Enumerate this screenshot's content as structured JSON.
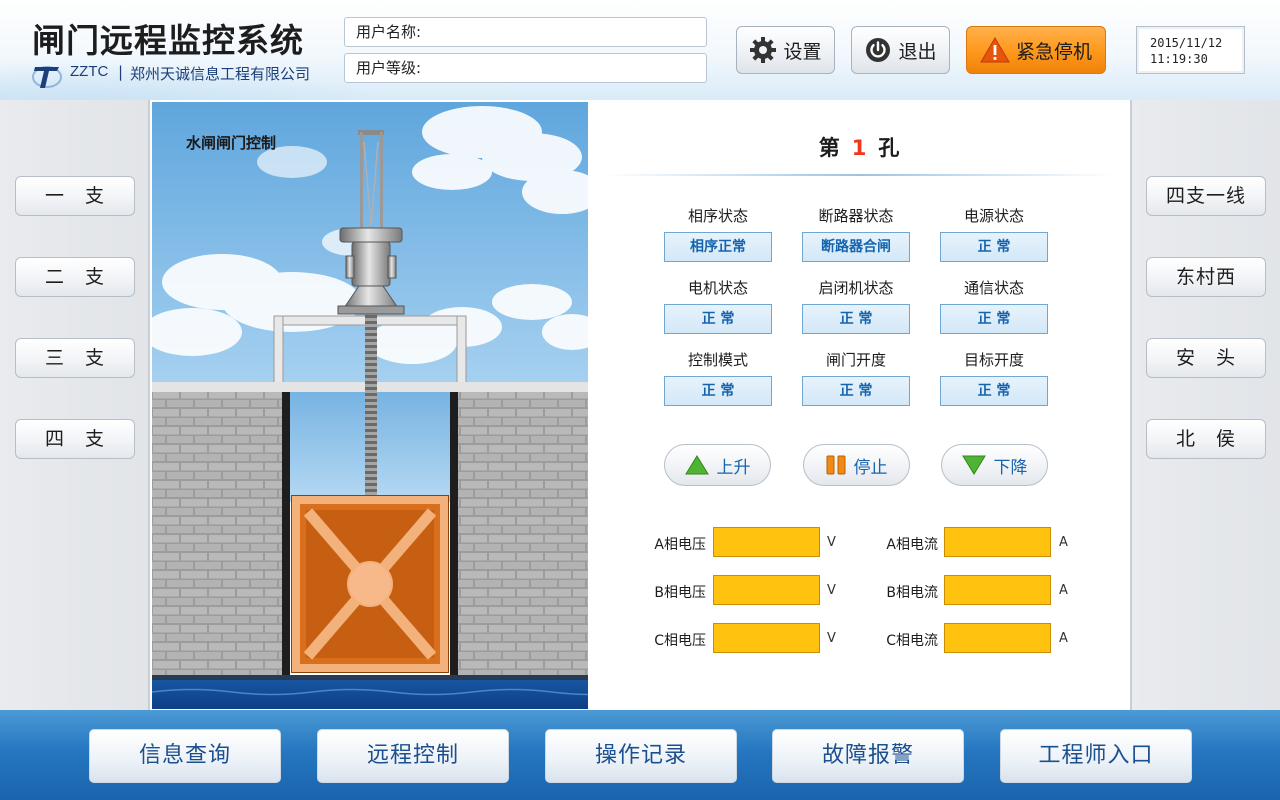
{
  "header": {
    "title": "闸门远程监控系统",
    "company_code": "ZZTC",
    "company_separator": "|",
    "company_name": "郑州天诚信息工程有限公司",
    "user_name_label": "用户名称:",
    "user_level_label": "用户等级:",
    "settings_label": "设置",
    "exit_label": "退出",
    "estop_label": "紧急停机",
    "date": "2015/11/12",
    "time": "11:19:30"
  },
  "left_nav": [
    "一　支",
    "二　支",
    "三　支",
    "四　支"
  ],
  "right_nav": [
    "四支一线",
    "东村西",
    "安　头",
    "北　侯"
  ],
  "scene": {
    "title": "水闸闸门控制"
  },
  "panel": {
    "hole_prefix": "第",
    "hole_number": "1",
    "hole_suffix": "孔",
    "status": [
      {
        "label": "相序状态",
        "value": "相序正常"
      },
      {
        "label": "断路器状态",
        "value": "断路器合闸"
      },
      {
        "label": "电源状态",
        "value": "正 常"
      },
      {
        "label": "电机状态",
        "value": "正 常"
      },
      {
        "label": "启闭机状态",
        "value": "正 常"
      },
      {
        "label": "通信状态",
        "value": "正 常"
      },
      {
        "label": "控制模式",
        "value": "正 常"
      },
      {
        "label": "闸门开度",
        "value": "正 常"
      },
      {
        "label": "目标开度",
        "value": "正 常"
      }
    ],
    "controls": {
      "up": "上升",
      "stop": "停止",
      "down": "下降"
    },
    "meters": [
      {
        "label": "A相电压",
        "unit": "V"
      },
      {
        "label": "A相电流",
        "unit": "A"
      },
      {
        "label": "B相电压",
        "unit": "V"
      },
      {
        "label": "B相电流",
        "unit": "A"
      },
      {
        "label": "C相电压",
        "unit": "V"
      },
      {
        "label": "C相电流",
        "unit": "A"
      }
    ]
  },
  "footer": [
    "信息查询",
    "远程控制",
    "操作记录",
    "故障报警",
    "工程师入口"
  ],
  "colors": {
    "accent_blue": "#1664ad",
    "estop_orange": "#ff9a1e",
    "meter_yellow": "#ffc20e",
    "hole_number_red": "#f0361c",
    "footer_blue": "#2577c0",
    "gate_orange": "#d86f1c"
  }
}
